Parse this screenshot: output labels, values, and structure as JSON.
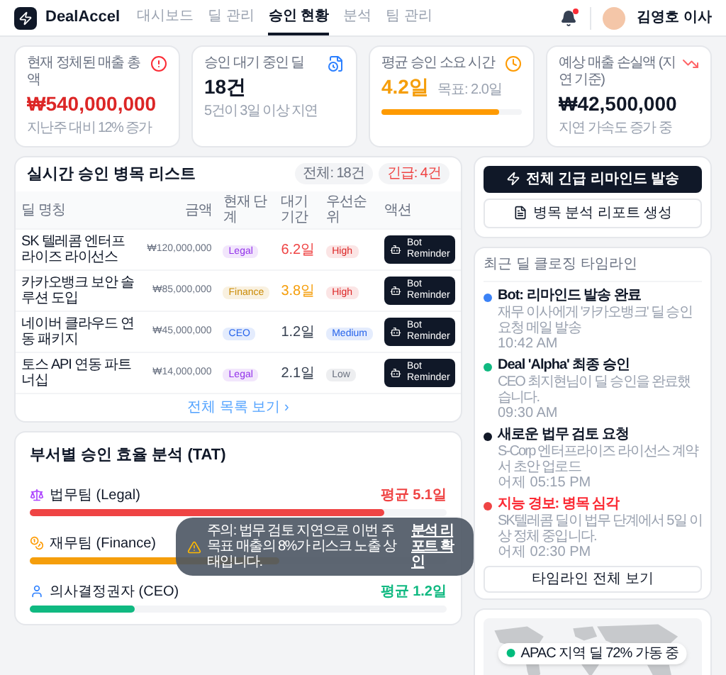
{
  "brand": {
    "name": "DealAccel"
  },
  "nav": [
    {
      "label": "대시보드",
      "selected": false
    },
    {
      "label": "딜 관리",
      "selected": false
    },
    {
      "label": "승인 현황",
      "selected": true
    },
    {
      "label": "분석",
      "selected": false
    },
    {
      "label": "팀 관리",
      "selected": false
    }
  ],
  "notifications": {
    "unread": true
  },
  "user": {
    "name": "김영호 이사"
  },
  "kpis": [
    {
      "label": "현재 정체된 매출 총액",
      "value": "₩540,000,000",
      "note": "지난주 대비 12% 증가",
      "color": "#dc2626"
    },
    {
      "label": "승인 대기 중인 딜",
      "value": "18건",
      "note": "5건이 3일 이상 지연",
      "color": "#111827"
    },
    {
      "label": "평균 승인 소요 시간",
      "value": "4.2일",
      "target": "목표: 2.0일",
      "color": "#f59e0b",
      "level": 0.84
    },
    {
      "label": "예상 매출 손실액 (지연 기준)",
      "value": "₩42,500,000",
      "note": "지연 가속도 증가 중",
      "color": "#111827"
    }
  ],
  "bottleneck": {
    "title": "실시간 승인 병목 리스트",
    "badges": [
      {
        "label": "전체: 18건",
        "color": "#6b7280"
      },
      {
        "label": "긴급: 4건",
        "color": "#ef4444"
      }
    ],
    "columns": [
      "딜 명칭",
      "금액",
      "현재 단계",
      "대기 기간",
      "우선순위",
      "액션"
    ],
    "rows": [
      {
        "deal": "SK 텔레콤 엔터프라이즈 라이선스",
        "amount": "₩120,000,000",
        "stage": {
          "label": "Legal",
          "color": "#9333ea"
        },
        "wait": {
          "label": "6.2일",
          "color": "#ef4444"
        },
        "priority": {
          "label": "High",
          "color": "#dc2626"
        },
        "action": "Bot Reminder"
      },
      {
        "deal": "카카오뱅크 보안 솔루션 도입",
        "amount": "₩85,000,000",
        "stage": {
          "label": "Finance",
          "color": "#ca8a04"
        },
        "wait": {
          "label": "3.8일",
          "color": "#f59e0b"
        },
        "priority": {
          "label": "High",
          "color": "#dc2626"
        },
        "action": "Bot Reminder"
      },
      {
        "deal": "네이버 클라우드 연동 패키지",
        "amount": "₩45,000,000",
        "stage": {
          "label": "CEO",
          "color": "#2563eb"
        },
        "wait": {
          "label": "1.2일",
          "color": "#374151"
        },
        "priority": {
          "label": "Medium",
          "color": "#2563eb"
        },
        "action": "Bot Reminder"
      },
      {
        "deal": "토스 API 연동 파트너십",
        "amount": "₩14,000,000",
        "stage": {
          "label": "Legal",
          "color": "#9333ea"
        },
        "wait": {
          "label": "2.1일",
          "color": "#374151"
        },
        "priority": {
          "label": "Low",
          "color": "#6b7280"
        },
        "action": "Bot Reminder"
      }
    ],
    "footer_link": "전체 목록 보기 ›"
  },
  "tat": {
    "title": "부서별 승인 효율 분석 (TAT)",
    "rows": [
      {
        "label": "법무팀 (Legal)",
        "color": "#ef4444",
        "level": 0.85,
        "reading": "평균 5.1일"
      },
      {
        "label": "재무팀 (Finance)",
        "color": "#f59e0b",
        "level": 0.6
      },
      {
        "label": "의사결정권자 (CEO)",
        "color": "#10b981",
        "level": 0.25,
        "reading": "평균 1.2일"
      }
    ]
  },
  "actions": {
    "primary": "전체 긴급 리마인드 발송",
    "secondary": "병목 분석 리포트 생성"
  },
  "timeline": {
    "title": "최근 딜 클로징 타임라인",
    "items": [
      {
        "title": "Bot: 리마인드 발송 완료",
        "desc": "재무 이사에게 '카카오뱅크' 딜 승인 요청 메일 발송",
        "time": "10:42 AM",
        "color": "#3b82f6",
        "alert": false
      },
      {
        "title": "Deal 'Alpha' 최종 승인",
        "desc": "CEO 최지현님이 딜 승인을 완료했습니다.",
        "time": "09:30 AM",
        "color": "#10b981",
        "alert": false
      },
      {
        "title": "새로운 법무 검토 요청",
        "desc": "S-Corp 엔터프라이즈 라이선스 계약서 초안 업로드",
        "time": "어제 05:15 PM",
        "color": "#111827",
        "alert": false
      },
      {
        "title": "지능 경보: 병목 심각",
        "desc": "SK텔레콤 딜이 법무 단계에서 5일 이상 정체 중입니다.",
        "time": "어제 02:30 PM",
        "color": "#ef4444",
        "alert": true
      }
    ],
    "button": "타임라인 전체 보기"
  },
  "map": {
    "badge": "APAC 지역 딜 72% 가동 중"
  },
  "toast": {
    "message": "주의: 법무 검토 지연으로 이번 주 목표 매출의 8%가 리스크 노출 상태입니다.",
    "link": "분석 리포트 확인"
  }
}
